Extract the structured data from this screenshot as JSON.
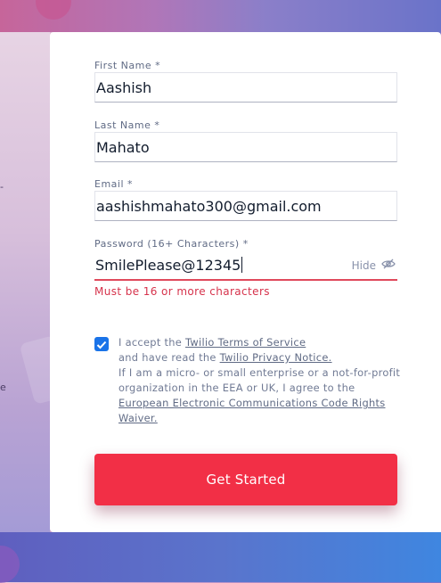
{
  "form": {
    "first_name": {
      "label": "First Name *",
      "value": "Aashish"
    },
    "last_name": {
      "label": "Last Name *",
      "value": "Mahato"
    },
    "email": {
      "label": "Email *",
      "value": "aashishmahato300@gmail.com"
    },
    "password": {
      "label": "Password (16+ Characters) *",
      "value": "SmilePlease@12345",
      "toggle_label": "Hide",
      "error": "Must be 16 or more characters"
    },
    "terms": {
      "checked": true,
      "accept_prefix": "I accept the ",
      "tos_link": "Twilio Terms of Service",
      "read_prefix": "and have read the ",
      "privacy_link": "Twilio Privacy Notice.",
      "micro_text": "If I am a micro- or small enterprise or a not-for-profit organization in the EEA or UK, I agree to the",
      "eecc_link": "European Electronic Communications Code Rights Waiver."
    },
    "submit_label": "Get Started"
  },
  "colors": {
    "accent": "#f22f46",
    "checkbox": "#1a73e8",
    "error": "#d6334c"
  },
  "icons": [
    "eye-slash-icon",
    "check-icon"
  ]
}
